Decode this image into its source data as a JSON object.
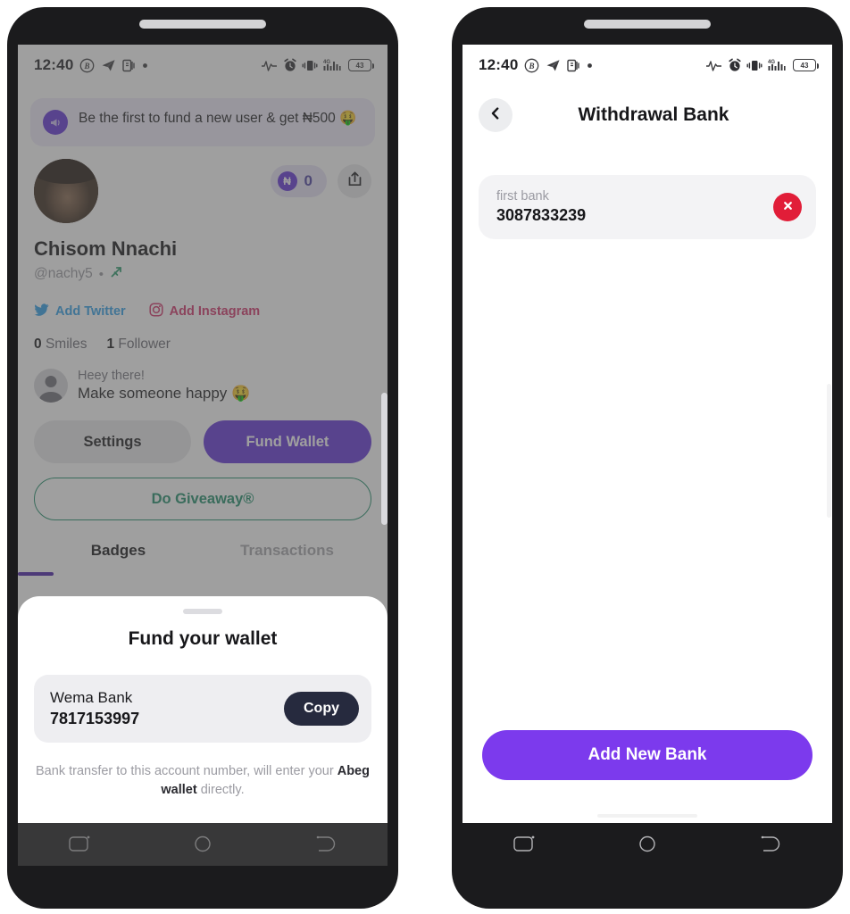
{
  "status_bar": {
    "time": "12:40",
    "left_icons": [
      "circled-b-icon",
      "telegram-icon",
      "app-icon",
      "dot-icon"
    ],
    "right_icons": [
      "pulse-icon",
      "alarm-icon",
      "vibrate-icon",
      "signal-4g-icon"
    ],
    "battery_level": "43",
    "network": "4G"
  },
  "left_phone": {
    "promo": {
      "icon": "megaphone-icon",
      "text": "Be the first to fund a new user & get ₦500 🤑"
    },
    "profile": {
      "avatar": "user-avatar",
      "balance_symbol": "₦",
      "balance": "0",
      "share_icon": "share-icon",
      "name": "Chisom Nnachi",
      "handle": "@nachy5",
      "separator": "•",
      "zodiac_icon": "sagittarius-icon",
      "socials": [
        {
          "label": "Add Twitter",
          "icon": "twitter-icon",
          "color": "#2f9fe8"
        },
        {
          "label": "Add Instagram",
          "icon": "instagram-icon",
          "color": "#d3346a"
        }
      ],
      "stats": [
        {
          "count": "0",
          "label": "Smiles"
        },
        {
          "count": "1",
          "label": "Follower"
        }
      ],
      "bio_line1": "Heey there!",
      "bio_line2": "Make someone happy 🤑"
    },
    "actions": {
      "settings_label": "Settings",
      "fund_wallet_label": "Fund Wallet",
      "giveaway_label": "Do Giveaway®"
    },
    "tabs": [
      {
        "label": "Badges",
        "active": true
      },
      {
        "label": "Transactions",
        "active": false
      }
    ],
    "sheet": {
      "title": "Fund your wallet",
      "bank_name": "Wema Bank",
      "account_number": "7817153997",
      "copy_label": "Copy",
      "note_before": "Bank transfer to this account number, will enter your ",
      "note_bold": "Abeg wallet",
      "note_after": " directly."
    }
  },
  "right_phone": {
    "header": {
      "back_icon": "chevron-left-icon",
      "title": "Withdrawal Bank"
    },
    "banks": [
      {
        "bank_name": "first bank",
        "account_number": "3087833239",
        "delete_icon": "close-circle-icon"
      }
    ],
    "add_bank_label": "Add New Bank"
  },
  "nav_bar": {
    "items": [
      "recents-icon",
      "home-icon",
      "back-icon"
    ]
  },
  "colors": {
    "primary_purple": "#6333d8",
    "accent_purple": "#7c3aed",
    "green": "#1f8f6a",
    "red": "#e11d38",
    "dark": "#262a3e"
  }
}
